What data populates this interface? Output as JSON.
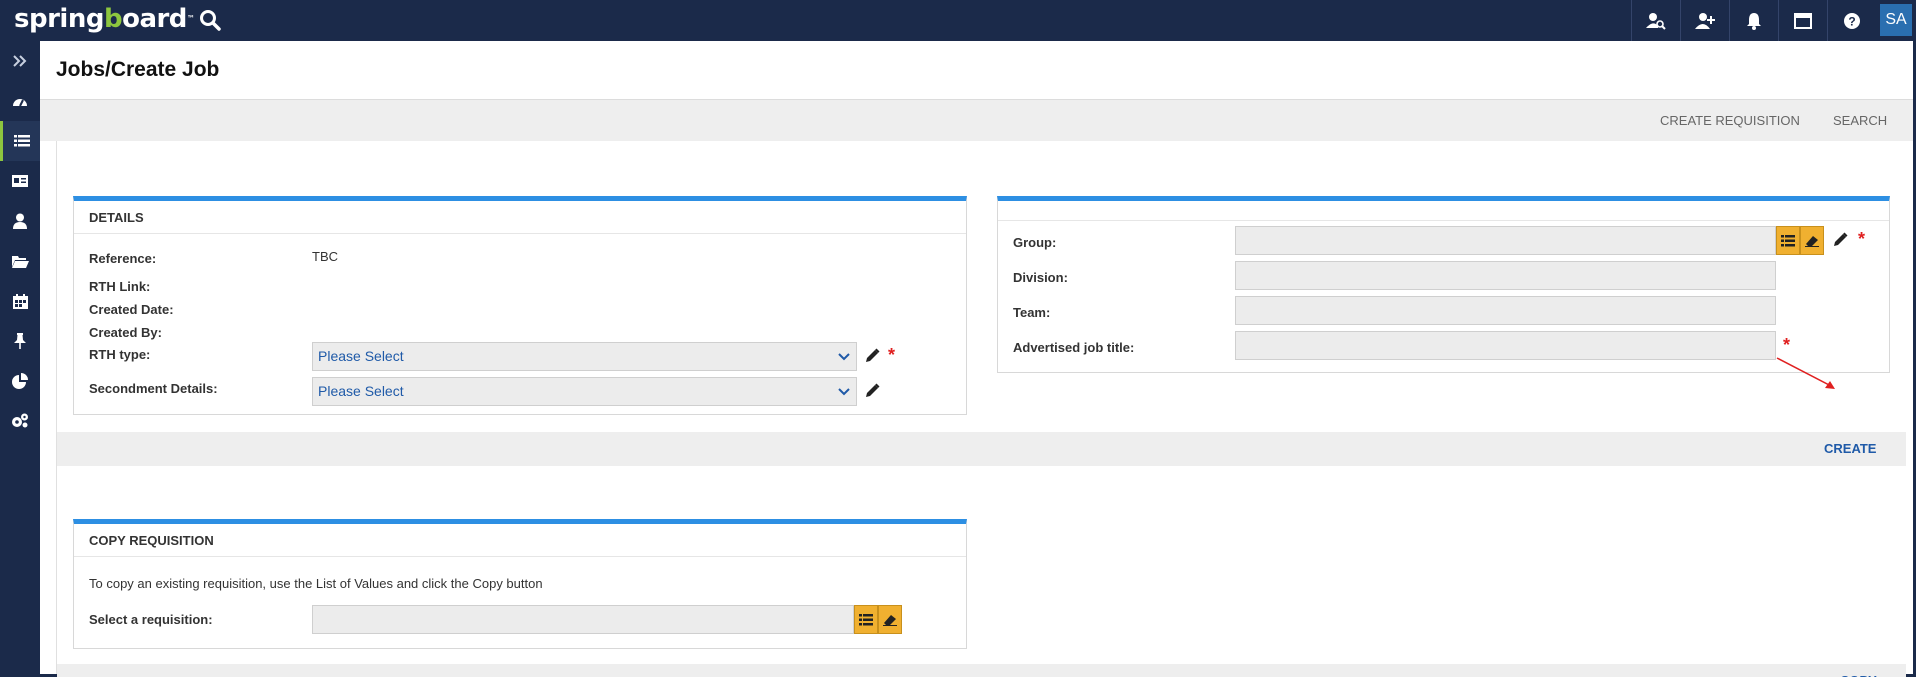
{
  "app": {
    "logo_prefix": "spring",
    "logo_g": "b",
    "logo_suffix": "oard",
    "logo_mark": "™",
    "user_initials": "SA"
  },
  "top_icons": [
    "user-search-icon",
    "add-user-icon",
    "bell-icon",
    "window-icon",
    "help-icon"
  ],
  "sidenav": [
    "expand-icon",
    "dashboard-icon",
    "list-icon",
    "id-card-icon",
    "user-icon",
    "folder-icon",
    "calendar-icon",
    "pin-icon",
    "pie-chart-icon",
    "settings-icon"
  ],
  "page": {
    "title": "Jobs/Create Job",
    "sublinks": {
      "create_requisition": "CREATE REQUISITION",
      "search": "SEARCH"
    }
  },
  "details": {
    "heading": "DETAILS",
    "reference_label": "Reference:",
    "reference_value": "TBC",
    "rth_link_label": "RTH Link:",
    "created_date_label": "Created Date:",
    "created_by_label": "Created By:",
    "rth_type_label": "RTH type:",
    "rth_type_value": "Please Select",
    "secondment_label": "Secondment Details:",
    "secondment_value": "Please Select",
    "required_marker": "*"
  },
  "org": {
    "group_label": "Group:",
    "division_label": "Division:",
    "team_label": "Team:",
    "advertised_label": "Advertised job title:",
    "required_marker": "*"
  },
  "create_action": "CREATE",
  "copy": {
    "heading": "COPY REQUISITION",
    "instruction": "To copy an existing requisition, use the List of Values and click the Copy button",
    "select_label": "Select a requisition:",
    "action": "COPY"
  },
  "colors": {
    "navy": "#1b2a4a",
    "accent_green": "#8dc63f",
    "panel_blue": "#2d8fe3",
    "link_blue": "#1f5aa8",
    "lov_orange": "#f0b030",
    "required_red": "#e02020"
  }
}
